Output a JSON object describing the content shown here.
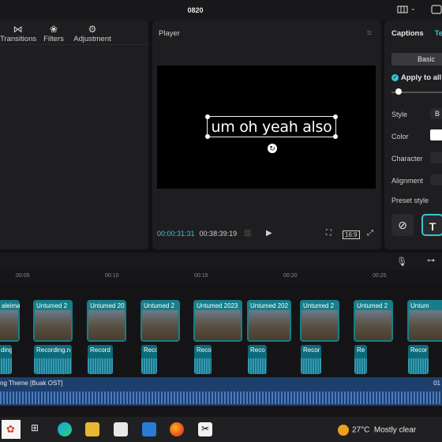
{
  "titlebar": {
    "project_name": "0820"
  },
  "left_tabs": [
    {
      "icon": "transitions-icon",
      "label": "Transitions"
    },
    {
      "icon": "filters-icon",
      "label": "Filters"
    },
    {
      "icon": "adjustment-icon",
      "label": "Adjustment"
    }
  ],
  "player": {
    "title": "Player",
    "caption_text": "um oh yeah also",
    "current_time": "00:00:31:31",
    "total_time": "00:38:39:19",
    "aspect_ratio": "16:9"
  },
  "captions": {
    "tab_active": "Captions",
    "tab_second": "Te",
    "basic_label": "Basic",
    "apply_all_label": "Apply to all",
    "style_label": "Style",
    "style_value": "B",
    "color_label": "Color",
    "character_label": "Character",
    "alignment_label": "Alignment",
    "preset_style_label": "Preset style"
  },
  "ruler_ticks": [
    "00:05",
    "00:10",
    "00:15",
    "00:20",
    "00:25"
  ],
  "video_clips": [
    "aleima",
    "Untumed 2",
    "Untumed 20",
    "Untumed 2",
    "Untumed 2023",
    "Untumed 202",
    "Untumed 2",
    "Untumed 2",
    "Untum"
  ],
  "audio_clips": [
    "ding",
    "Recording.n",
    "Record",
    "Reco",
    "Reco",
    "Reco",
    "Recor",
    "Re",
    "Recor"
  ],
  "music_track": {
    "label": "ng Theme [Buak OST]",
    "end_label": "01"
  },
  "taskbar": {
    "temperature": "27°C",
    "weather": "Mostly clear"
  }
}
